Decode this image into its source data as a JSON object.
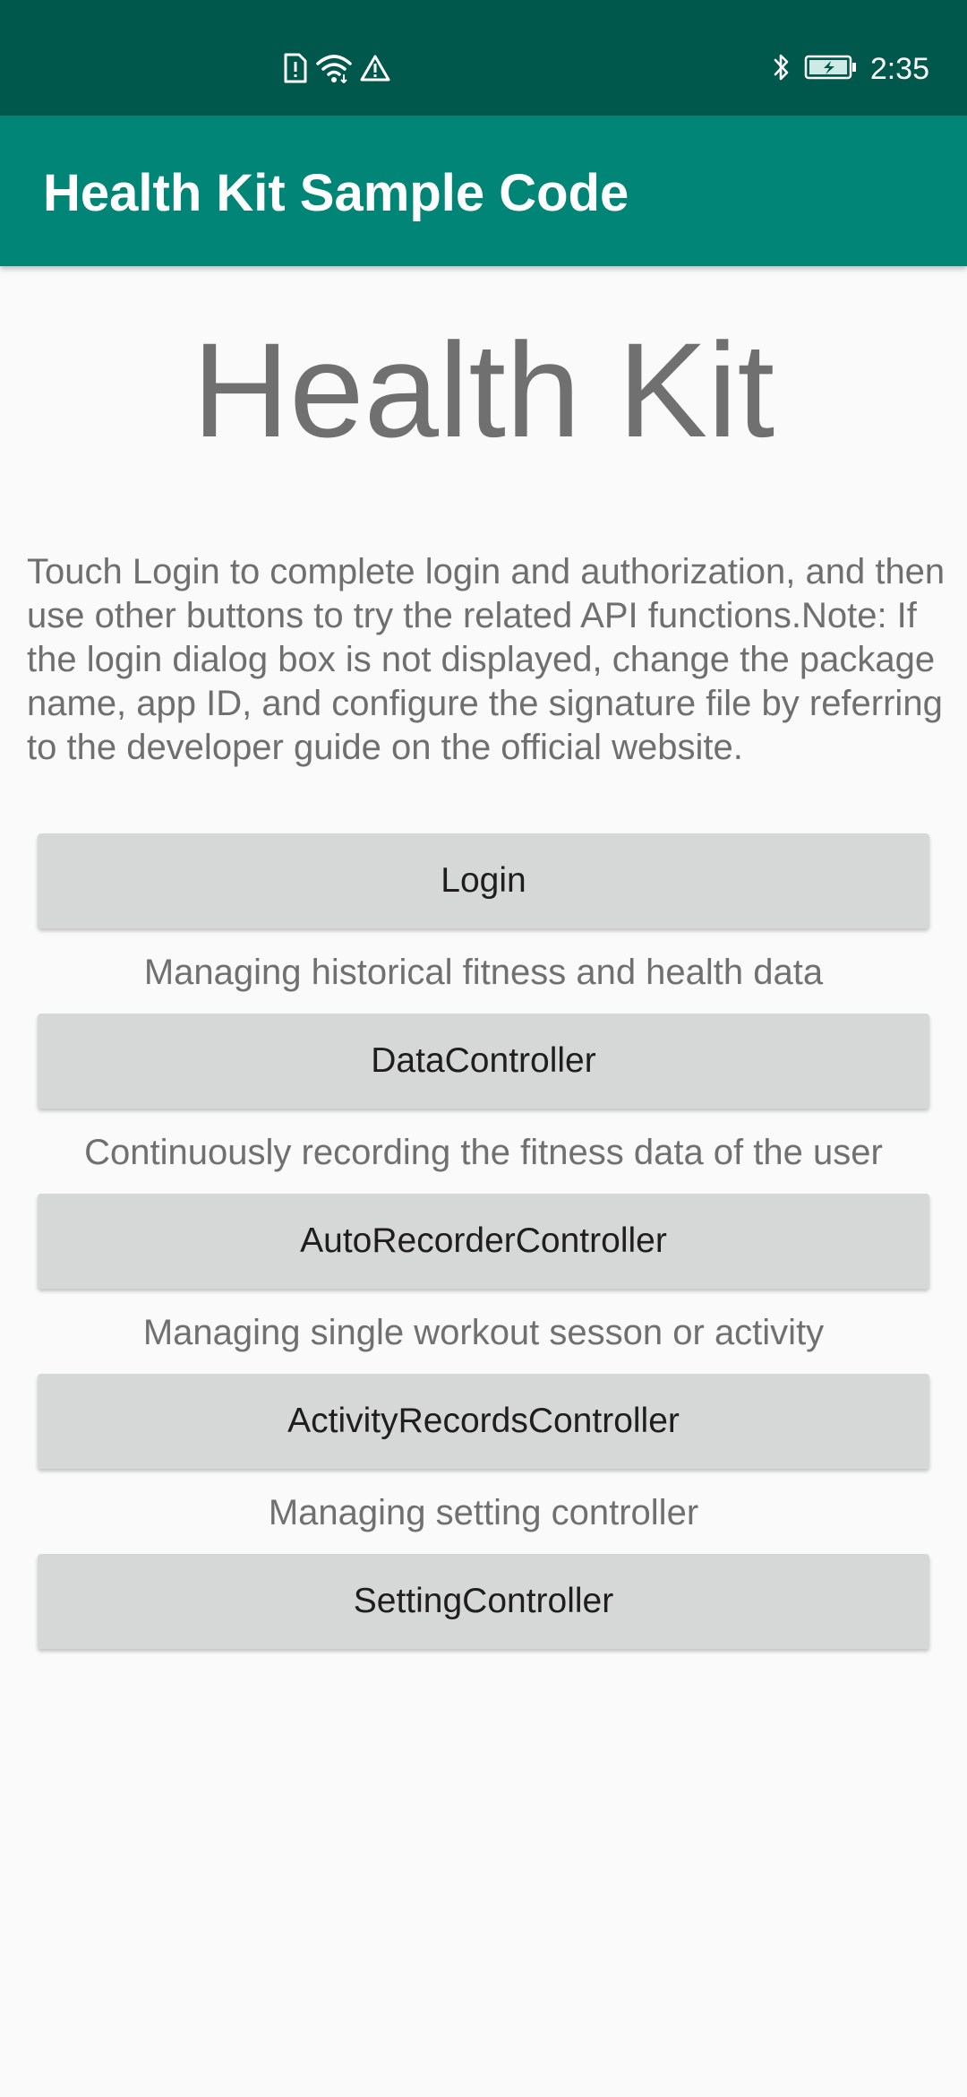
{
  "status_bar": {
    "time": "2:35",
    "icons": [
      "sim-alert-icon",
      "wifi-icon",
      "warning-icon",
      "bluetooth-icon",
      "battery-charging-icon"
    ],
    "background": "#00574b"
  },
  "app_bar": {
    "title": "Health Kit Sample Code",
    "background": "#008577"
  },
  "main": {
    "hero_title": "Health Kit",
    "intro": "Touch Login to complete login and authorization, and then use other buttons to try the related API functions.Note: If the login dialog box is not displayed, change the package name, app ID, and configure the signature file by referring to the developer guide on the official website.",
    "login_button": "Login",
    "data_caption": "Managing historical fitness and health data",
    "data_button": "DataController",
    "auto_recorder_caption": "Continuously recording the fitness data of the user",
    "auto_recorder_button": "AutoRecorderController",
    "activity_caption": "Managing single workout sesson or activity",
    "activity_button": "ActivityRecordsController",
    "setting_caption": "Managing setting controller",
    "setting_button": "SettingController"
  }
}
